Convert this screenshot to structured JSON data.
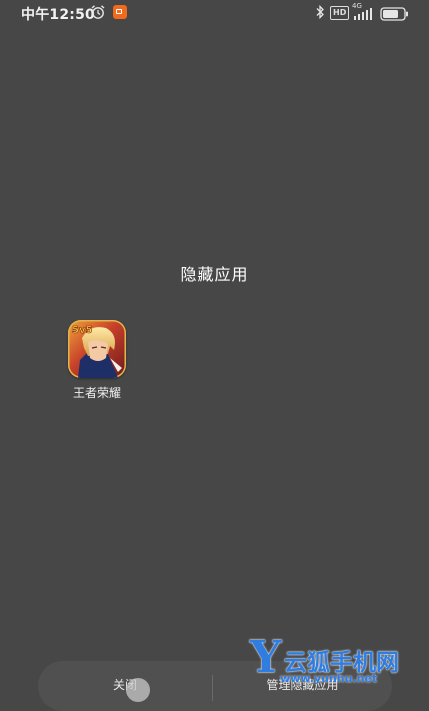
{
  "status_bar": {
    "time": "中午12:50",
    "hd_label": "HD",
    "network_label": "4G",
    "battery_level": 0.75
  },
  "page": {
    "title": "隐藏应用"
  },
  "apps": [
    {
      "label": "王者荣耀",
      "icon": "honor-of-kings-app-icon",
      "icon_badge": "5v5"
    }
  ],
  "bottom_bar": {
    "close_label": "关闭",
    "manage_label": "管理隐藏应用"
  },
  "watermark": {
    "logo_letter": "Y",
    "logo_text": "云狐手机网",
    "url": "www.yunhu.net"
  },
  "colors": {
    "background": "#474747",
    "notification_accent": "#f26b1d",
    "watermark_blue": "#2f7de1"
  }
}
